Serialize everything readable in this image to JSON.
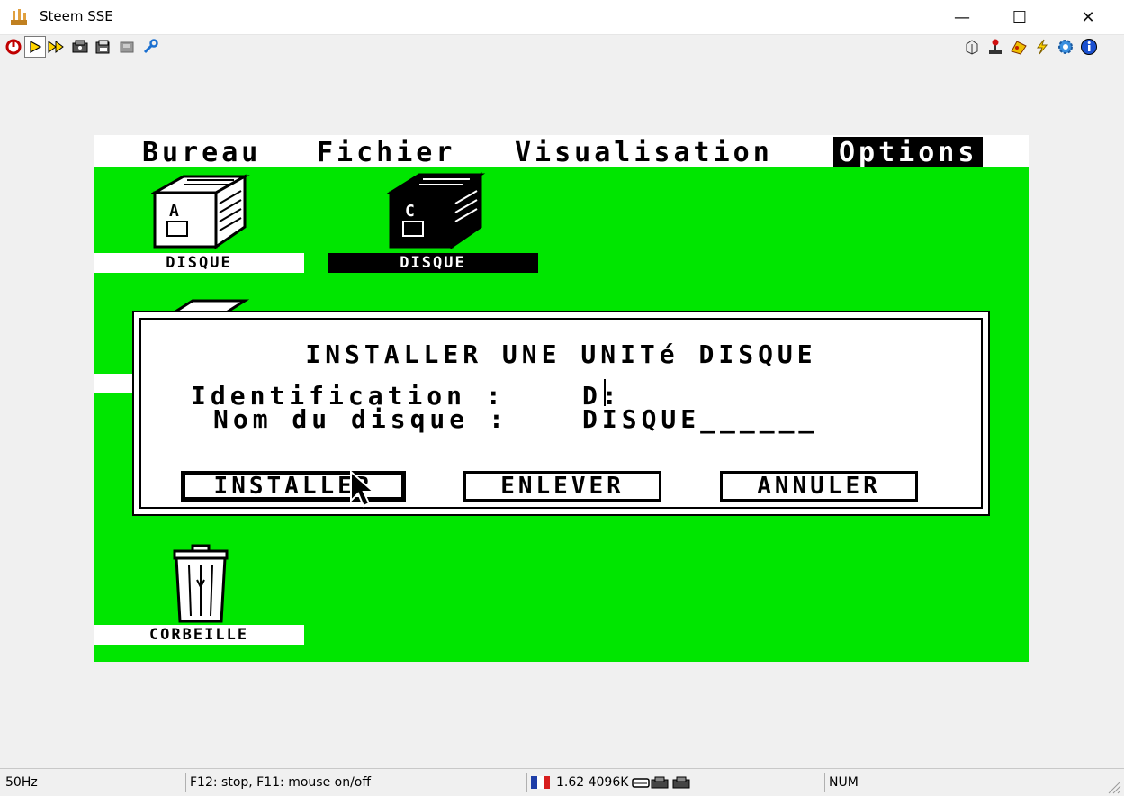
{
  "window": {
    "title": "Steem SSE",
    "minimize_glyph": "—",
    "maximize_glyph": "☐",
    "close_glyph": "✕"
  },
  "toolbar": {
    "left_icons": [
      "power-icon",
      "play-icon",
      "fast-forward-icon",
      "disk-drive-icon",
      "disk-swap-icon",
      "memory-snapshot-icon",
      "wrench-icon"
    ],
    "right_icons": [
      "cartridge-icon",
      "joystick-icon",
      "patches-icon",
      "shortcuts-icon",
      "options-gear-icon",
      "info-icon"
    ]
  },
  "atari": {
    "menu": {
      "bureau": "Bureau",
      "fichier": "Fichier",
      "visualisation": "Visualisation",
      "options": "Options"
    },
    "desktop_color": "#00e600",
    "icons": {
      "drive_a_label": "DISQUE",
      "drive_b_label": "DISQUE",
      "trash_label": "CORBEILLE"
    },
    "dialog": {
      "title": "INSTALLER UNE UNITé DISQUE",
      "identification_label": "Identification :",
      "identification_value": "D:",
      "name_label": "Nom du disque :",
      "name_value": "DISQUE______",
      "install_button": "INSTALLER",
      "remove_button": "ENLEVER",
      "cancel_button": "ANNULER"
    }
  },
  "status": {
    "refresh": "50Hz",
    "hint": "F12: stop, F11: mouse on/off",
    "info": "1.62 4096K",
    "num": "NUM"
  }
}
